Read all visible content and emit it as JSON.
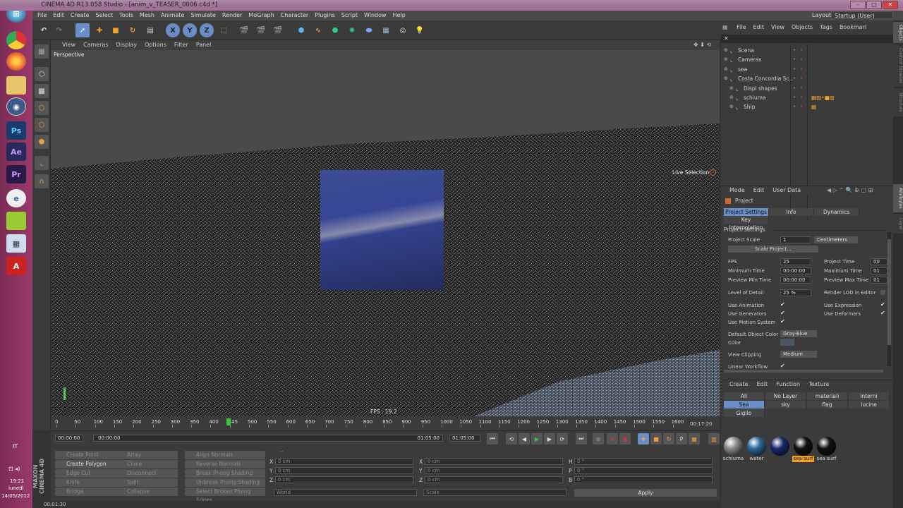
{
  "window": {
    "title": "CINEMA 4D R13.058 Studio - [anim_v_TEASER_0006.c4d *]",
    "layout_label": "Layout:",
    "layout_value": "Startup (User)"
  },
  "menubar": [
    "File",
    "Edit",
    "Create",
    "Select",
    "Tools",
    "Mesh",
    "Animate",
    "Simulate",
    "Render",
    "MoGraph",
    "Character",
    "Plugins",
    "Script",
    "Window",
    "Help"
  ],
  "viewport": {
    "menu": [
      "View",
      "Cameras",
      "Display",
      "Options",
      "Filter",
      "Panel"
    ],
    "camera_label": "Perspective",
    "live_selection": "Live Selection",
    "fps": "FPS : 19.2"
  },
  "timeline": {
    "ticks": [
      "0",
      "50",
      "100",
      "150",
      "200",
      "250",
      "300",
      "350",
      "400",
      "445",
      "500",
      "550",
      "600",
      "650",
      "700",
      "750",
      "800",
      "850",
      "900",
      "950",
      "1000",
      "1050",
      "1100",
      "1150",
      "1200",
      "1250",
      "1300",
      "1350",
      "1400",
      "1450",
      "1500",
      "1550",
      "1600"
    ],
    "current_frame": "445",
    "time_display": "00:17:20",
    "start": "00:00:00",
    "range_start": "00:00:00",
    "range_end": "01:05:00",
    "end": "01:05:00"
  },
  "modeling": {
    "col1": [
      "Create Point",
      "Create Polygon",
      "Edge Cut",
      "Knife",
      "Bridge"
    ],
    "col2": [
      "Array",
      "Clone",
      "Disconnect",
      "Split",
      "Collapse"
    ],
    "col3": [
      "Align Normals",
      "Reverse Normals",
      "Break Phong Shading",
      "Unbreak Phong Shading",
      "Select Broken Phong Edges"
    ]
  },
  "coords": {
    "header": "--",
    "rows": [
      {
        "a": "X",
        "av": "0 cm",
        "b": "X",
        "bv": "0 cm",
        "c": "H",
        "cv": "0 °"
      },
      {
        "a": "Y",
        "av": "0 cm",
        "b": "Y",
        "bv": "0 cm",
        "c": "P",
        "cv": "0 °"
      },
      {
        "a": "Z",
        "av": "0 cm",
        "b": "Z",
        "bv": "0 cm",
        "c": "B",
        "cv": "0 °"
      }
    ],
    "world": "World",
    "scale": "Scale",
    "apply": "Apply"
  },
  "status": "00:01:30",
  "object_manager": {
    "menu": [
      "File",
      "Edit",
      "View",
      "Objects",
      "Tags",
      "Bookmarl"
    ],
    "items": [
      {
        "name": "Scena",
        "indent": 0
      },
      {
        "name": "Cameras",
        "indent": 0
      },
      {
        "name": "sea",
        "indent": 0
      },
      {
        "name": "Costa Concordia Sc..",
        "indent": 0
      },
      {
        "name": "Displ shapes",
        "indent": 1
      },
      {
        "name": "schiuma",
        "indent": 1
      },
      {
        "name": "Ship",
        "indent": 1
      }
    ]
  },
  "attributes": {
    "menu": [
      "Mode",
      "Edit",
      "User Data"
    ],
    "object": "Project",
    "tabs": [
      "Project Settings",
      "Info",
      "Dynamics"
    ],
    "tab2": "Key Interpolation",
    "section": "Project Settings",
    "project_scale_label": "Project Scale",
    "project_scale": "1",
    "units": "Centimeters",
    "scale_project_btn": "Scale Project...",
    "fps_label": "FPS",
    "fps": "25",
    "project_time_label": "Project Time",
    "project_time": "00",
    "min_time_label": "Minimum Time",
    "min_time": "00:00:00",
    "max_time_label": "Maximum Time",
    "max_time": "01",
    "prev_min_label": "Preview Min Time",
    "prev_min": "00:00:00",
    "prev_max_label": "Preview Max Time",
    "prev_max": "01",
    "lod_label": "Level of Detail",
    "lod": "25 %",
    "render_lod_label": "Render LOD in Editor",
    "use_anim": "Use Animation",
    "use_expr": "Use Expression",
    "use_gen": "Use Generators",
    "use_def": "Use Deformers",
    "use_motion": "Use Motion System",
    "def_color_label": "Default Object Color",
    "def_color": "Gray-Blue",
    "color_label": "Color",
    "clip_label": "View Clipping",
    "clip": "Medium",
    "linear_label": "Linear Workflow"
  },
  "material_manager": {
    "menu": [
      "Create",
      "Edit",
      "Function",
      "Texture"
    ],
    "filters_row1": [
      "All",
      "No Layer",
      "materiali carena",
      "interni"
    ],
    "filters_row2": [
      "Sea",
      "sky",
      "flag",
      "lucine"
    ],
    "filters_row3": [
      "Giglio"
    ],
    "materials": [
      {
        "name": "schiuma",
        "color": "#8a8a8a"
      },
      {
        "name": "water",
        "color": "#2d6a9a"
      },
      {
        "name": "",
        "color": "#1a2a6a"
      },
      {
        "name": "sea surf",
        "color": "#111111"
      },
      {
        "name": "sea surf",
        "color": "#111111"
      }
    ]
  },
  "sidebar_tabs": [
    "Objects",
    "Content Browser",
    "Structure",
    "Attributes",
    "Layer"
  ],
  "os": {
    "lang": "IT",
    "time": "19:21",
    "day": "lunedì",
    "date": "14/05/2012"
  },
  "colors": {
    "accent": "#f0a030",
    "selected": "#6a8fc8",
    "taskbar": "#8a3562"
  }
}
